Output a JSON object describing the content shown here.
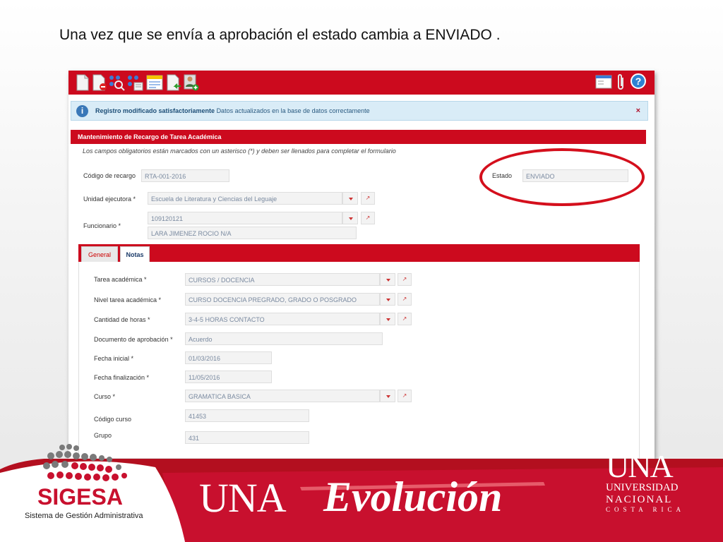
{
  "slide": {
    "title": "Una vez que se envía a aprobación el estado cambia a ENVIADO ."
  },
  "toolbar": {
    "icons": [
      "new-document-icon",
      "delete-document-icon",
      "search-icon",
      "list-icon",
      "form-icon",
      "export-icon",
      "user-add-icon"
    ],
    "right_icons": [
      "window-icon",
      "attachment-icon",
      "help-icon"
    ],
    "help_label": "?"
  },
  "alert": {
    "title": "Registro modificado satisfactoriamente",
    "message": "Datos actualizados en la base de datos correctamente",
    "icon_label": "i",
    "close_label": "×"
  },
  "form": {
    "section_title": "Mantenimiento de Recargo de Tarea Académica",
    "required_note": "Los campos obligatorios están marcados con un asterisco (*) y deben ser llenados para completar el formulario",
    "codigo_label": "Código de recargo",
    "codigo_value": "RTA-001-2016",
    "estado_label": "Estado",
    "estado_value": "ENVIADO",
    "unidad_label": "Unidad ejecutora *",
    "unidad_value": "Escuela de Literatura y Ciencias del Leguaje",
    "funcionario_label": "Funcionario *",
    "funcionario_id": "109120121",
    "funcionario_name": "LARA  JIMENEZ ROCIO N/A",
    "link_glyph": "↗"
  },
  "tabs": {
    "general": "General",
    "notas": "Notas"
  },
  "detail": {
    "tarea_label": "Tarea académica *",
    "tarea_value": "CURSOS / DOCENCIA",
    "nivel_label": "Nivel tarea académica *",
    "nivel_value": "CURSO DOCENCIA PREGRADO, GRADO O POSGRADO",
    "horas_label": "Cantidad de horas *",
    "horas_value": "3-4-5 HORAS CONTACTO",
    "documento_label": "Documento de aprobación *",
    "documento_value": "Acuerdo",
    "fecha_inicial_label": "Fecha inicial *",
    "fecha_inicial_value": "01/03/2016",
    "fecha_fin_label": "Fecha finalización *",
    "fecha_fin_value": "11/05/2016",
    "curso_label": "Curso *",
    "curso_value": "GRAMATICA BASICA",
    "codigo_curso_label": "Código curso",
    "codigo_curso_value": "41453",
    "grupo_label": "Grupo",
    "grupo_value": "431"
  },
  "banner": {
    "sigesa": "SIGESA",
    "sigesa_sub": "Sistema de Gestión Administrativa",
    "una": "UNA",
    "evolucion": "Evolución",
    "logo_una": "UNA",
    "logo_line1": "UNIVERSIDAD",
    "logo_line2": "NACIONAL",
    "logo_line3": "COSTA RICA"
  },
  "colors": {
    "primary_red": "#cc0a1e",
    "alert_bg": "#d9ecf7",
    "oval": "#d40f1c"
  }
}
